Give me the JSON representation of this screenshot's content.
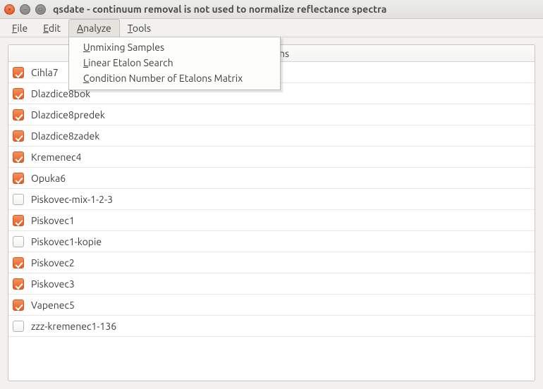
{
  "window": {
    "title": "qsdate - continuum removal is not used to normalize reflectance spectra",
    "buttons": {
      "close": "×",
      "minimize": "–",
      "maximize": "▫"
    }
  },
  "menubar": {
    "items": [
      {
        "label": "File"
      },
      {
        "label": "Edit"
      },
      {
        "label": "Analyze",
        "active": true
      },
      {
        "label": "Tools"
      }
    ]
  },
  "dropdown": {
    "open_under": "Analyze",
    "items": [
      {
        "label": "Unmixing Samples"
      },
      {
        "label": "Linear Etalon Search"
      },
      {
        "label": "Condition Number of Etalons Matrix"
      }
    ]
  },
  "table": {
    "header_visible_fragment": "ns",
    "rows": [
      {
        "checked": true,
        "label": "Cihla7"
      },
      {
        "checked": true,
        "label": "Dlazdice8bok"
      },
      {
        "checked": true,
        "label": "Dlazdice8predek"
      },
      {
        "checked": true,
        "label": "Dlazdice8zadek"
      },
      {
        "checked": true,
        "label": "Kremenec4"
      },
      {
        "checked": true,
        "label": "Opuka6"
      },
      {
        "checked": false,
        "label": "Piskovec-mix-1-2-3"
      },
      {
        "checked": true,
        "label": "Piskovec1"
      },
      {
        "checked": false,
        "label": "Piskovec1-kopie"
      },
      {
        "checked": true,
        "label": "Piskovec2"
      },
      {
        "checked": true,
        "label": "Piskovec3"
      },
      {
        "checked": true,
        "label": "Vapenec5"
      },
      {
        "checked": false,
        "label": "zzz-kremenec1-136"
      }
    ]
  }
}
